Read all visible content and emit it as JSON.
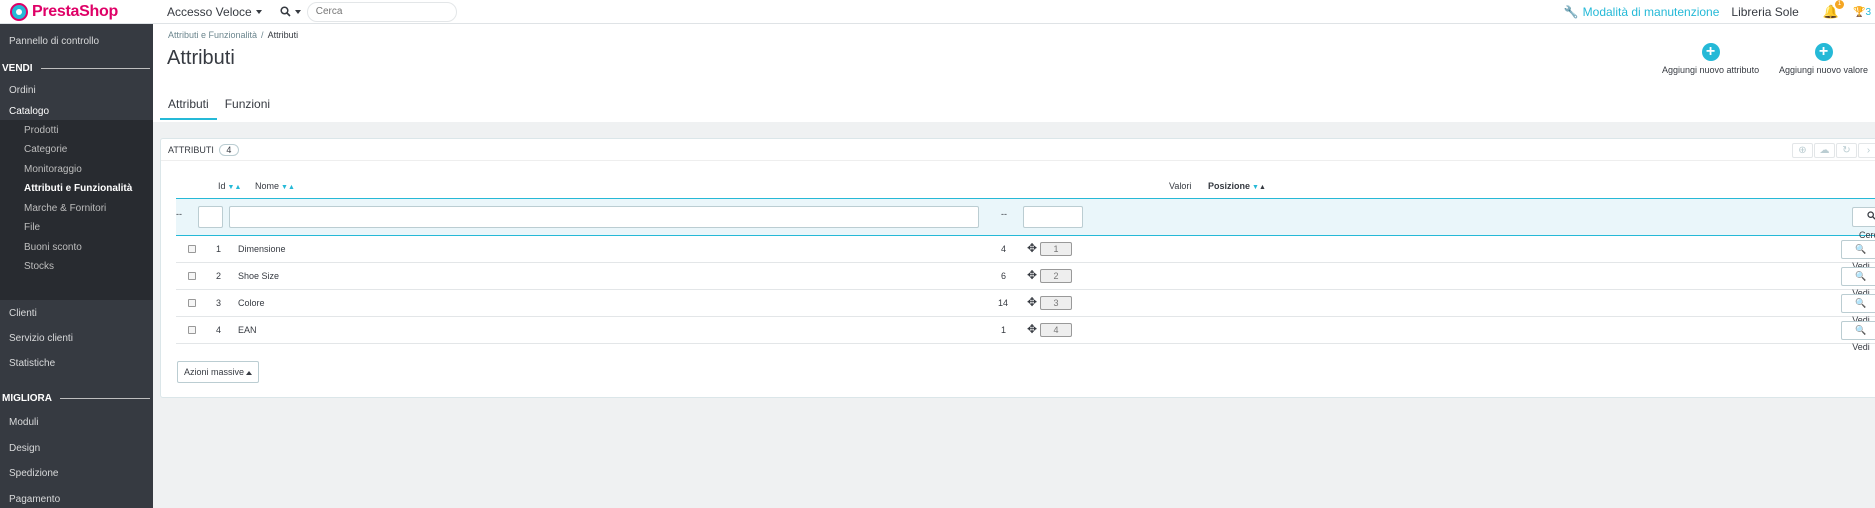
{
  "header": {
    "logo_text": "PrestaShop",
    "quick_access": "Accesso Veloce",
    "search_placeholder": "Cerca",
    "maintenance": "Modalità di manutenzione",
    "shop_name": "Libreria Sole",
    "notifications_count": "1",
    "trophy_count": "3"
  },
  "sidebar": {
    "dashboard": "Pannello di controllo",
    "section_sell": "VENDI",
    "orders": "Ordini",
    "catalog": "Catalogo",
    "catalog_items": [
      "Prodotti",
      "Categorie",
      "Monitoraggio",
      "Attributi e Funzionalità",
      "Marche & Fornitori",
      "File",
      "Buoni sconto",
      "Stocks"
    ],
    "customers": "Clienti",
    "customer_service": "Servizio clienti",
    "stats": "Statistiche",
    "section_improve": "MIGLIORA",
    "modules": "Moduli",
    "design": "Design",
    "shipping": "Spedizione",
    "payment": "Pagamento"
  },
  "page": {
    "breadcrumb_parent": "Attributi e Funzionalità",
    "breadcrumb_sep": "/",
    "breadcrumb_current": "Attributi",
    "title": "Attributi",
    "btn_add_attribute": "Aggiungi nuovo attributo",
    "btn_add_value": "Aggiungi nuovo valore",
    "tab_attributes": "Attributi",
    "tab_features": "Funzioni"
  },
  "panel": {
    "title": "ATTRIBUTI",
    "count": "4",
    "col_id": "Id",
    "col_name": "Nome",
    "col_values": "Valori",
    "col_position": "Posizione",
    "filter_dash": "--",
    "search_button": "Cerca",
    "view_label": "Vedi",
    "bulk_actions": "Azioni massive",
    "rows": [
      {
        "id": "1",
        "name": "Dimensione",
        "values": "4",
        "position": "1"
      },
      {
        "id": "2",
        "name": "Shoe Size",
        "values": "6",
        "position": "2"
      },
      {
        "id": "3",
        "name": "Colore",
        "values": "14",
        "position": "3"
      },
      {
        "id": "4",
        "name": "EAN",
        "values": "1",
        "position": "4"
      }
    ]
  }
}
